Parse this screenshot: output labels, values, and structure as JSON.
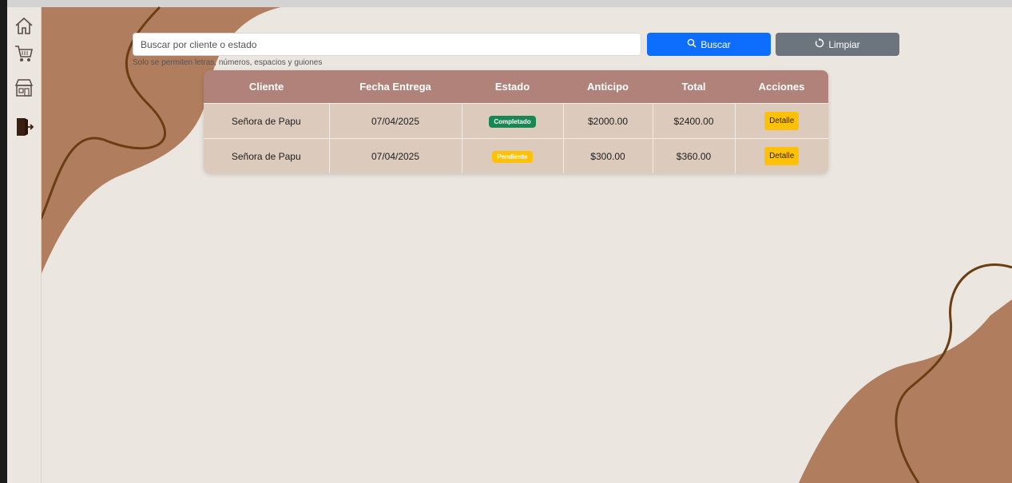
{
  "nav": {
    "items": [
      {
        "icon": "home-icon"
      },
      {
        "icon": "cart-icon"
      },
      {
        "icon": "store-icon"
      },
      {
        "icon": "logout-icon"
      }
    ]
  },
  "search": {
    "placeholder": "Buscar por cliente o estado",
    "hint": "Solo se permiten letras, números, espacios y guiones",
    "buscar_label": "Buscar",
    "buscar_icon": "search-icon",
    "limpiar_label": "Limpiar",
    "limpiar_icon": "refresh-icon"
  },
  "table": {
    "headers": [
      "Cliente",
      "Fecha Entrega",
      "Estado",
      "Anticipo",
      "Total",
      "Acciones"
    ],
    "rows": [
      {
        "cliente": "Señora de Papu",
        "fecha": "07/04/2025",
        "estado": "Completado",
        "estado_color": "#198754",
        "anticipo": "$2000.00",
        "total": "$2400.00",
        "accion": "Detalle"
      },
      {
        "cliente": "Señora de Papu",
        "fecha": "07/04/2025",
        "estado": "Pendiente",
        "estado_color": "#ffc107",
        "anticipo": "$300.00",
        "total": "$360.00",
        "accion": "Detalle"
      }
    ]
  },
  "colors": {
    "background": "#ece6e0",
    "blob": "#b07d5e",
    "curve": "#6b3e12",
    "header": "#b0827a",
    "row": "#dccbbd",
    "primary": "#0d6efd",
    "secondary": "#6c757d",
    "warning": "#ffc107"
  }
}
